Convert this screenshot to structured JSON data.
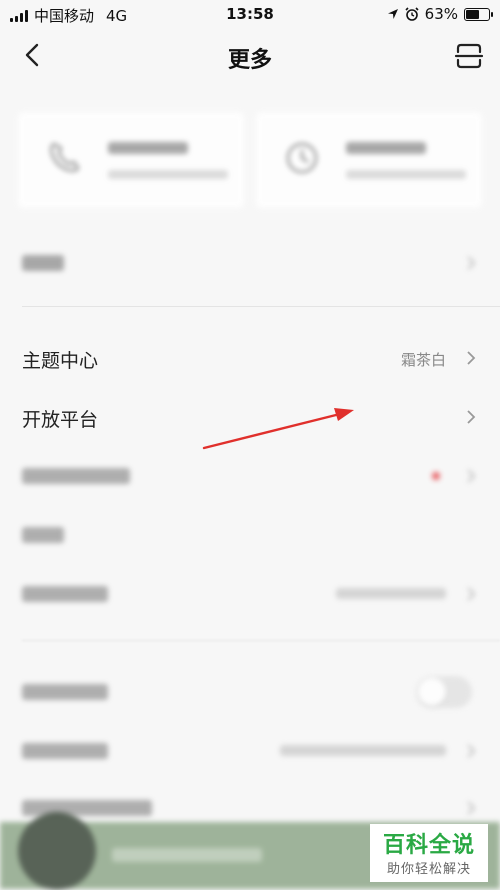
{
  "status_bar": {
    "carrier": "中国移动",
    "network": "4G",
    "time": "13:58",
    "battery": "63%",
    "battery_level": 0.63
  },
  "header": {
    "title": "更多",
    "back_icon": "chevron-left-icon",
    "scan_icon": "scan-icon"
  },
  "cards": [
    {
      "title": "",
      "subtitle": "",
      "icon": "phone-icon"
    },
    {
      "title": "",
      "subtitle": "",
      "icon": "clock-icon"
    }
  ],
  "menu": {
    "theme": {
      "label": "主题中心",
      "value": "霜茶白"
    },
    "open_platform": {
      "label": "开放平台"
    }
  },
  "blurred_rows": 7,
  "watermark": {
    "title": "百科全说",
    "subtitle": "助你轻松解决"
  },
  "colors": {
    "arrow": "#e0302c",
    "accent_green": "#2aa944",
    "badge_red": "#e5484d"
  }
}
